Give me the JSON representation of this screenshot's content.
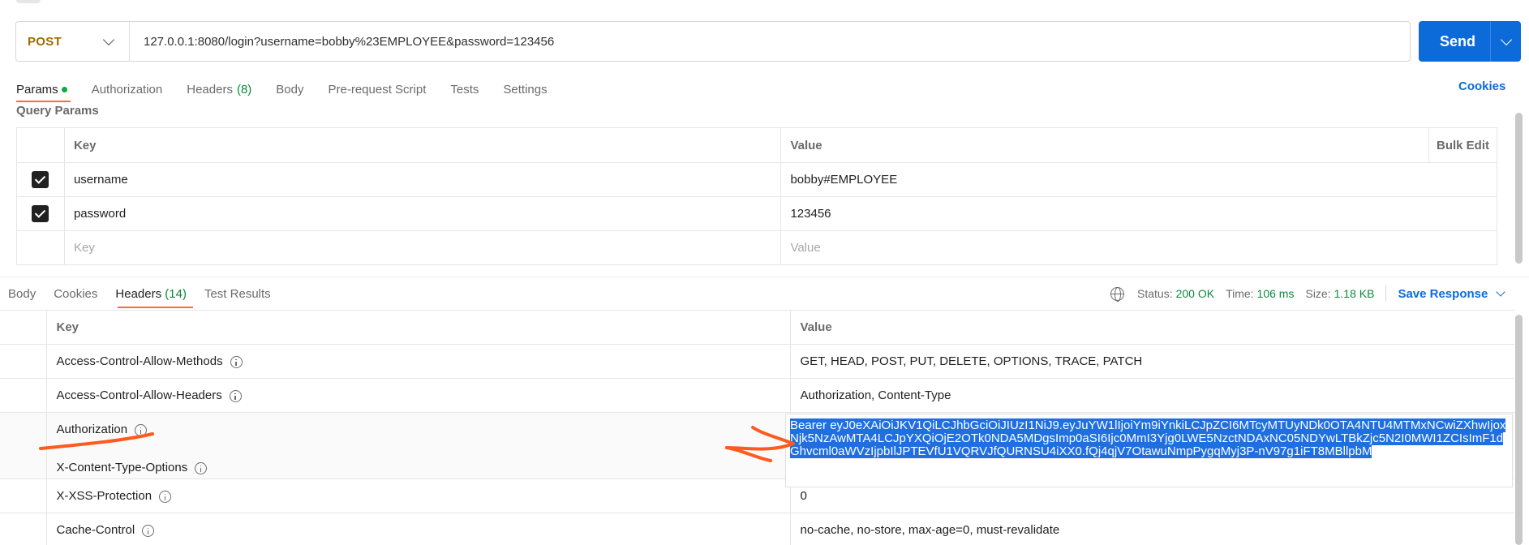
{
  "request": {
    "method": "POST",
    "url": "127.0.0.1:8080/login?username=bobby%23EMPLOYEE&password=123456",
    "send_label": "Send"
  },
  "request_tabs": [
    {
      "label": "Params",
      "count": "",
      "active": true
    },
    {
      "label": "Authorization",
      "count": ""
    },
    {
      "label": "Headers",
      "count": "(8)"
    },
    {
      "label": "Body",
      "count": ""
    },
    {
      "label": "Pre-request Script",
      "count": ""
    },
    {
      "label": "Tests",
      "count": ""
    },
    {
      "label": "Settings",
      "count": ""
    }
  ],
  "cookies_label": "Cookies",
  "query_params": {
    "title": "Query Params",
    "col_key": "Key",
    "col_value": "Value",
    "bulk_edit": "Bulk Edit",
    "rows": [
      {
        "checked": true,
        "key": "username",
        "value": "bobby#EMPLOYEE"
      },
      {
        "checked": true,
        "key": "password",
        "value": "123456"
      }
    ],
    "placeholder_key": "Key",
    "placeholder_value": "Value"
  },
  "response_tabs": [
    {
      "label": "Body",
      "count": ""
    },
    {
      "label": "Cookies",
      "count": ""
    },
    {
      "label": "Headers",
      "count": "(14)",
      "active": true
    },
    {
      "label": "Test Results",
      "count": ""
    }
  ],
  "status": {
    "status_label": "Status:",
    "status_value": "200 OK",
    "time_label": "Time:",
    "time_value": "106 ms",
    "size_label": "Size:",
    "size_value": "1.18 KB",
    "save_response": "Save Response"
  },
  "response_headers": {
    "col_key": "Key",
    "col_value": "Value",
    "rows": [
      {
        "key": "Access-Control-Allow-Methods",
        "value": "GET, HEAD, POST, PUT, DELETE, OPTIONS, TRACE, PATCH"
      },
      {
        "key": "Access-Control-Allow-Headers",
        "value": "Authorization, Content-Type"
      },
      {
        "key": "Authorization",
        "value": ""
      },
      {
        "key": "X-Content-Type-Options",
        "value": ""
      },
      {
        "key": "X-XSS-Protection",
        "value": "0"
      },
      {
        "key": "Cache-Control",
        "value": "no-cache, no-store, max-age=0, must-revalidate"
      }
    ],
    "authorization_token": "Bearer eyJ0eXAiOiJKV1QiLCJhbGciOiJIUzI1NiJ9.eyJuYW1lIjoiYm9iYnkiLCJpZCI6MTcyMTUyNDk0OTA4NTU4MTMxNCwiZXhwIjoxNjk5NzAwMTA4LCJpYXQiOjE2OTk0NDA5MDgsImp0aSI6Ijc0MmI3Yjg0LWE5NzctNDAxNC05NDYwLTBkZjc5N2I0MWI1ZCIsImF1dGhvcml0aWVzIjpbIlJPTEVfU1VQRVJfQURNSU4iXX0.fQj4qjV7OtawuNmpPygqMyj3P-nV97g1iFT8MBllpbM"
  },
  "colors": {
    "accent": "#ff6c37",
    "primary": "#0d6bd9",
    "success": "#0a8a3c",
    "method_post": "#a06a00",
    "selection": "#1f6fe0"
  }
}
